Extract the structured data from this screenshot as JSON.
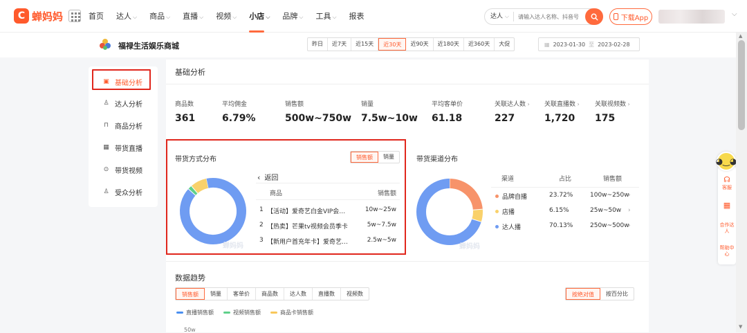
{
  "header": {
    "logo_text": "蝉妈妈",
    "nav": [
      {
        "label": "首页",
        "has_menu": false,
        "active": false
      },
      {
        "label": "达人",
        "has_menu": true,
        "active": false
      },
      {
        "label": "商品",
        "has_menu": true,
        "active": false
      },
      {
        "label": "直播",
        "has_menu": true,
        "active": false
      },
      {
        "label": "视频",
        "has_menu": true,
        "active": false
      },
      {
        "label": "小店",
        "has_menu": true,
        "active": true
      },
      {
        "label": "品牌",
        "has_menu": true,
        "active": false
      },
      {
        "label": "工具",
        "has_menu": true,
        "active": false
      },
      {
        "label": "报表",
        "has_menu": false,
        "active": false
      }
    ],
    "search_type": "达人",
    "search_placeholder": "请输入达人名称、抖音号",
    "download_label": "下载App"
  },
  "shop": {
    "name": "福禄生活娱乐商城",
    "ranges": [
      "昨日",
      "近7天",
      "近15天",
      "近30天",
      "近90天",
      "近180天",
      "近360天",
      "大促"
    ],
    "active_range": "近30天",
    "date_start": "2023-01-30",
    "date_end": "2023-02-28"
  },
  "sidebar": {
    "items": [
      {
        "label": "基础分析",
        "icon": "chart-icon",
        "active": true
      },
      {
        "label": "达人分析",
        "icon": "person-icon",
        "active": false
      },
      {
        "label": "商品分析",
        "icon": "bag-icon",
        "active": false
      },
      {
        "label": "带货直播",
        "icon": "tv-icon",
        "active": false
      },
      {
        "label": "带货视频",
        "icon": "play-icon",
        "active": false
      },
      {
        "label": "受众分析",
        "icon": "audience-icon",
        "active": false
      }
    ]
  },
  "basic": {
    "title": "基础分析",
    "metrics": [
      {
        "label": "商品数",
        "value": "361",
        "link": false
      },
      {
        "label": "平均佣金",
        "value": "6.79%",
        "link": false
      },
      {
        "label": "销售额",
        "value": "500w~750w",
        "link": false
      },
      {
        "label": "销量",
        "value": "7.5w~10w",
        "link": false
      },
      {
        "label": "平均客单价",
        "value": "61.18",
        "link": false
      },
      {
        "label": "关联达人数",
        "value": "227",
        "link": true
      },
      {
        "label": "关联直播数",
        "value": "1,720",
        "link": true
      },
      {
        "label": "关联视频数",
        "value": "175",
        "link": true
      }
    ]
  },
  "sales_mode": {
    "title": "带货方式分布",
    "toggle": [
      "销售额",
      "销量"
    ],
    "active_toggle": "销售额",
    "back_label": "返回",
    "col_product": "商品",
    "col_sales": "销售额",
    "rows": [
      {
        "rank": "1",
        "name": "【活动】爱奇艺白金VIP会员年卡",
        "sales": "10w~25w"
      },
      {
        "rank": "2",
        "name": "【热卖】芒果tv视频会员季卡",
        "sales": "5w~7.5w"
      },
      {
        "rank": "3",
        "name": "【新用户首充年卡】爱奇艺会员",
        "sales": "2.5w~5w"
      }
    ],
    "watermark": "蝉妈妈"
  },
  "channel": {
    "title": "带货渠道分布",
    "col_channel": "渠道",
    "col_share": "占比",
    "col_sales": "销售额",
    "rows": [
      {
        "name": "品牌自播",
        "share": "23.72%",
        "sales": "100w~250w",
        "color": "#f7936a"
      },
      {
        "name": "店播",
        "share": "6.15%",
        "sales": "25w~50w",
        "color": "#f9d16b"
      },
      {
        "name": "达人播",
        "share": "70.13%",
        "sales": "250w~500w",
        "color": "#6f9cf2"
      }
    ],
    "watermark": "蝉妈妈"
  },
  "trend": {
    "title": "数据趋势",
    "tabs": [
      "销售额",
      "销量",
      "客单价",
      "商品数",
      "达人数",
      "直播数",
      "视频数"
    ],
    "active_tab": "销售额",
    "modes": [
      "按绝对值",
      "按百分比"
    ],
    "active_mode": "按绝对值",
    "legend": [
      {
        "label": "直播销售额",
        "color": "#4a8ff0"
      },
      {
        "label": "视频销售额",
        "color": "#5fd08a"
      },
      {
        "label": "商品卡销售额",
        "color": "#f9c75a"
      }
    ],
    "y_tick": "50w"
  },
  "float": {
    "items": [
      "客服",
      "合作达人",
      "帮助中心"
    ]
  },
  "chart_data": [
    {
      "type": "pie",
      "title": "带货方式分布",
      "categories": [
        "直播",
        "视频",
        "商品卡"
      ],
      "values": [
        90,
        2,
        8
      ],
      "colors": [
        "#6f9cf2",
        "#5fd08a",
        "#f9d16b"
      ]
    },
    {
      "type": "pie",
      "title": "带货渠道分布",
      "categories": [
        "品牌自播",
        "店播",
        "达人播"
      ],
      "values": [
        23.72,
        6.15,
        70.13
      ],
      "colors": [
        "#f7936a",
        "#f9d16b",
        "#6f9cf2"
      ]
    }
  ]
}
